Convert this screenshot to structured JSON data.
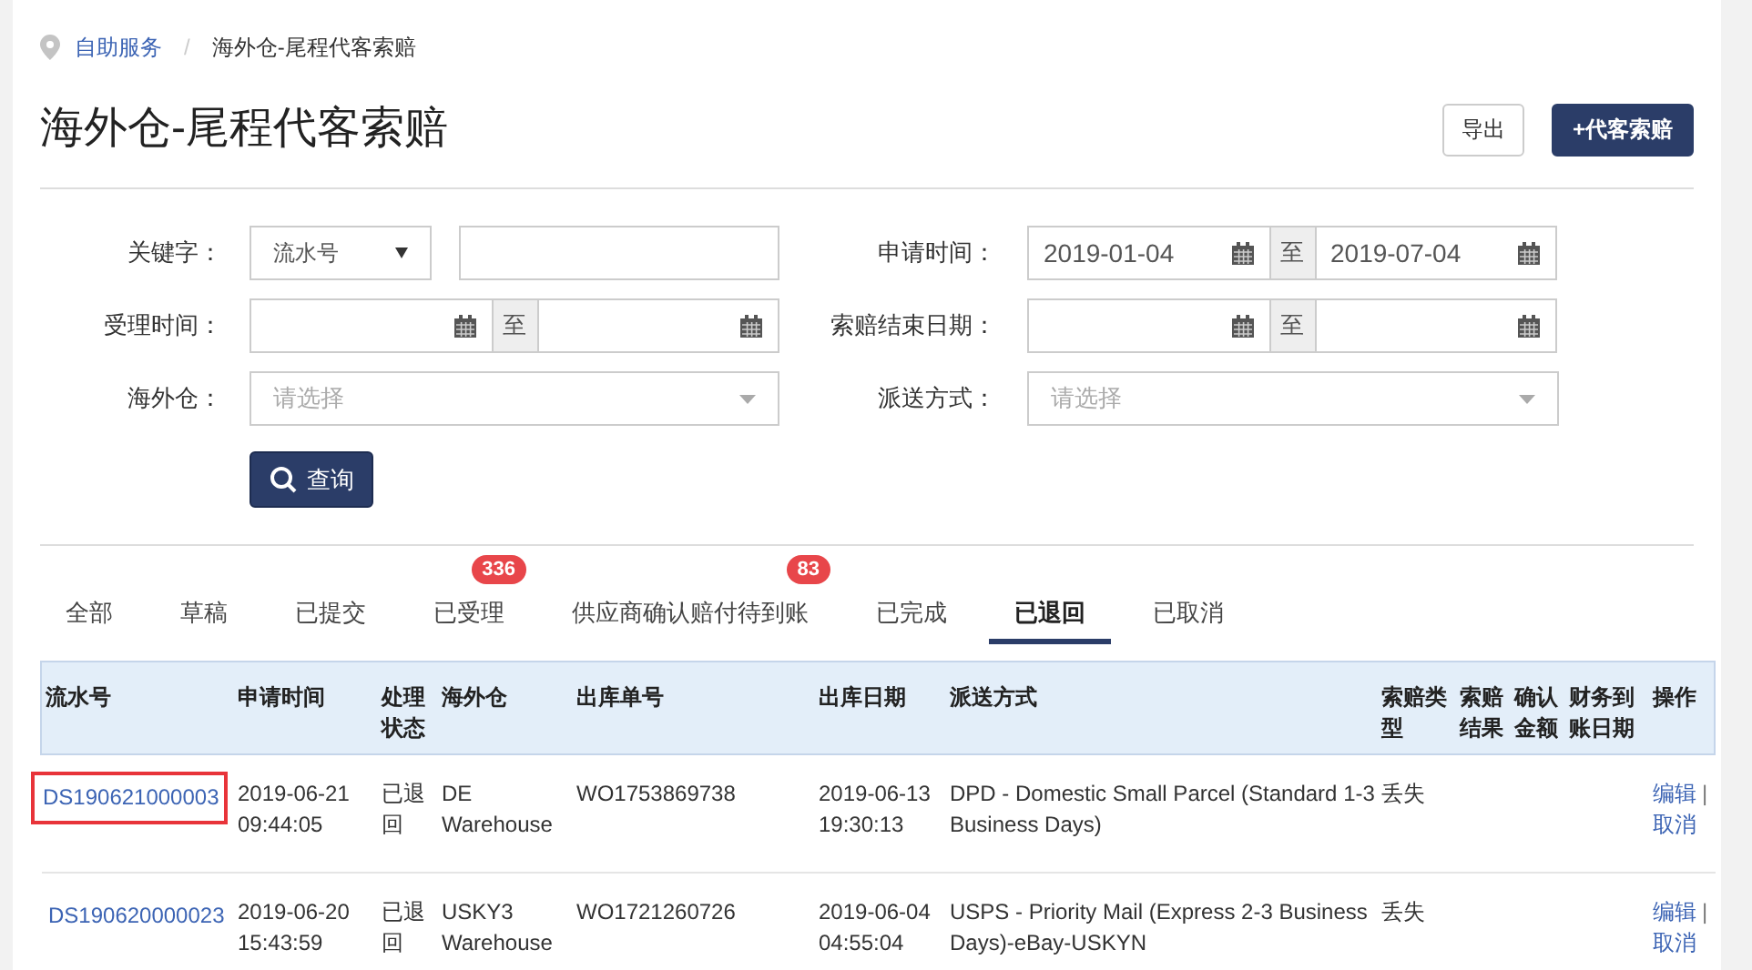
{
  "breadcrumb": {
    "items": [
      "自助服务",
      "海外仓-尾程代客索赔"
    ],
    "separator": "/"
  },
  "title": "海外仓-尾程代客索赔",
  "actions": [
    {
      "label": "导出",
      "kind": "outline"
    },
    {
      "label": "+代客索赔",
      "kind": "primary"
    }
  ],
  "filters": {
    "keyword": {
      "label": "关键字：",
      "type_value": "流水号"
    },
    "apply_time": {
      "label": "申请时间：",
      "from": "2019-01-04",
      "separator": "至",
      "to": "2019-07-04"
    },
    "accept_time": {
      "label": "受理时间：",
      "separator": "至"
    },
    "claim_end_date": {
      "label": "索赔结束日期：",
      "separator": "至"
    },
    "warehouse": {
      "label": "海外仓：",
      "placeholder": "请选择"
    },
    "shipping": {
      "label": "派送方式：",
      "placeholder": "请选择"
    },
    "search_button": "查询"
  },
  "tabs": [
    {
      "label": "全部",
      "selected": false
    },
    {
      "label": "草稿",
      "selected": false
    },
    {
      "label": "已提交",
      "selected": false
    },
    {
      "label": "已受理",
      "selected": false,
      "badge": "336"
    },
    {
      "label": "供应商确认赔付待到账",
      "selected": false,
      "badge": "83"
    },
    {
      "label": "已完成",
      "selected": false
    },
    {
      "label": "已退回",
      "selected": true
    },
    {
      "label": "已取消",
      "selected": false
    }
  ],
  "table": {
    "columns": [
      "流水号",
      "申请时间",
      "处理状态",
      "海外仓",
      "出库单号",
      "出库日期",
      "派送方式",
      "索赔类型",
      "索赔结果",
      "确认金额",
      "财务到账日期",
      "操作"
    ],
    "rows": [
      {
        "serial": "DS190621000003",
        "highlighted": true,
        "apply_time": "2019-06-21 09:44:05",
        "status": "已退回",
        "warehouse": "DE Warehouse",
        "outbound_no": "WO1753869738",
        "outbound_date": "2019-06-13 19:30:13",
        "shipping": "DPD - Domestic Small Parcel (Standard 1-3 Business Days)",
        "claim_type": "丢失",
        "actions": [
          "编辑",
          "|",
          "取消"
        ]
      },
      {
        "serial": "DS190620000023",
        "highlighted": false,
        "apply_time": "2019-06-20 15:43:59",
        "status": "已退回",
        "warehouse": "USKY3 Warehouse",
        "outbound_no": "WO1721260726",
        "outbound_date": "2019-06-04 04:55:04",
        "shipping": "USPS - Priority Mail (Express 2-3 Business Days)-eBay-USKYN",
        "claim_type": "丢失",
        "actions": [
          "编辑",
          "|",
          "取消"
        ]
      }
    ]
  }
}
